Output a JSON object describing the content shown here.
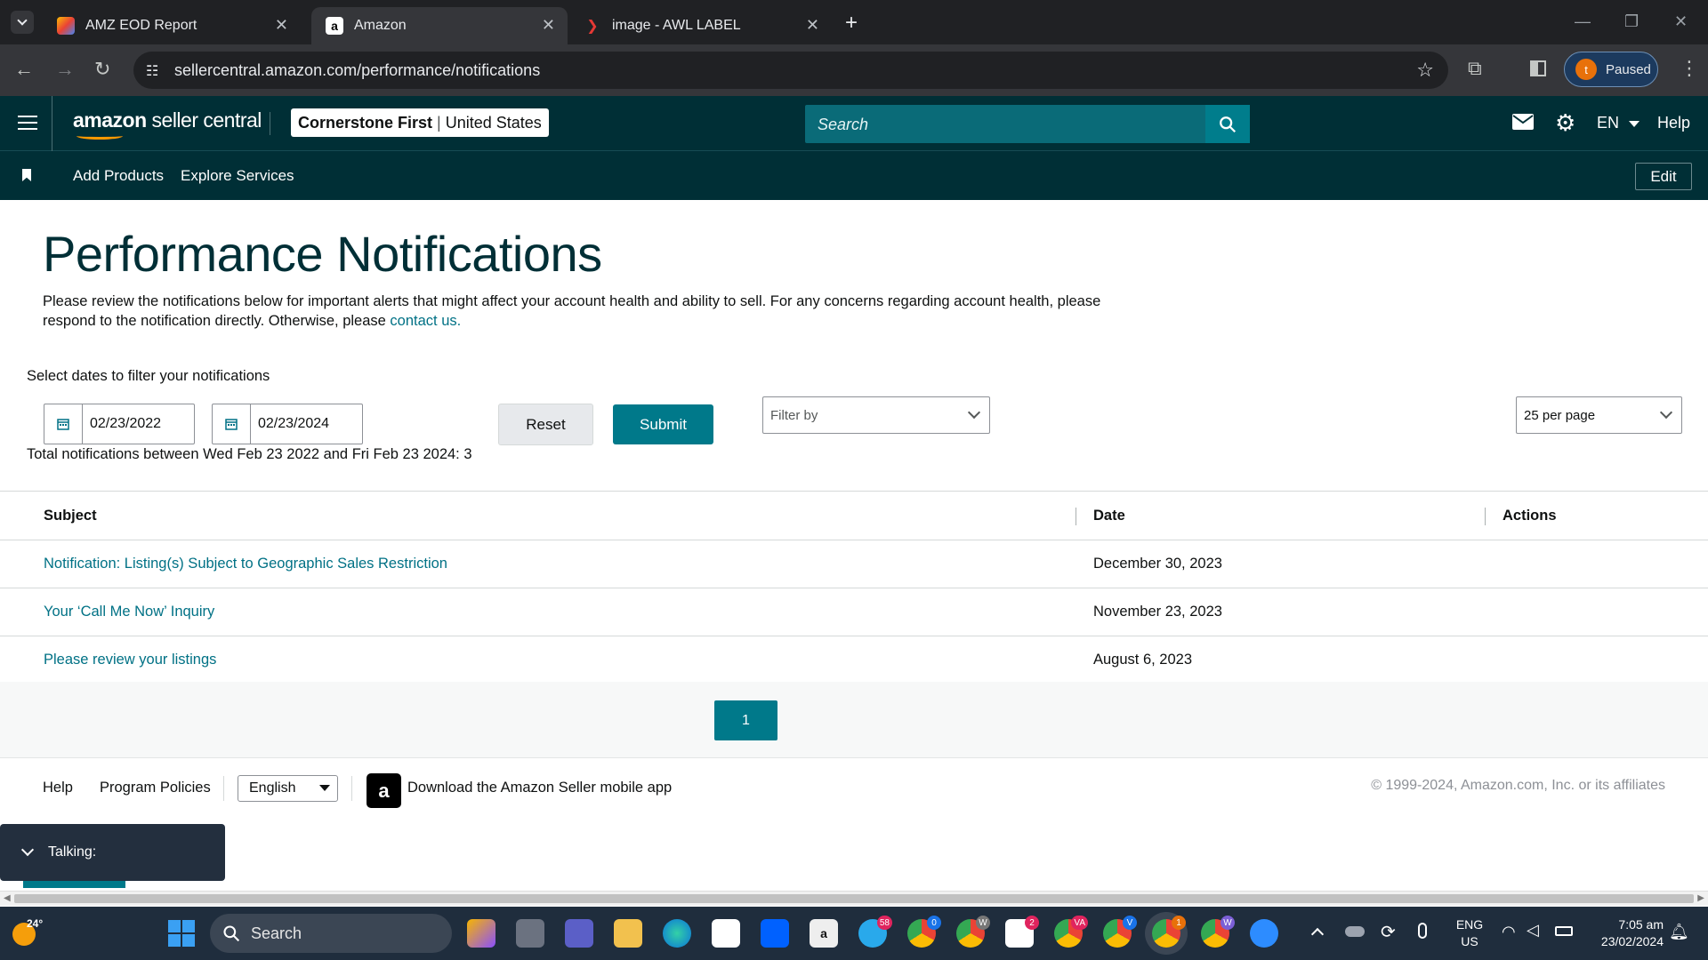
{
  "browser": {
    "tabs": [
      {
        "title": "AMZ EOD Report",
        "icon": "apps-script-icon"
      },
      {
        "title": "Amazon",
        "icon": "amazon-a-icon"
      },
      {
        "title": "image - AWL LABEL",
        "icon": "awl-icon"
      }
    ],
    "url": "sellercentral.amazon.com/performance/notifications",
    "profile": {
      "initial": "t",
      "status": "Paused"
    }
  },
  "header": {
    "logo_bold": "amazon",
    "logo_rest": " seller central",
    "store_name": "Cornerstone First",
    "store_region": "United States",
    "search_placeholder": "Search",
    "language": "EN",
    "help": "Help"
  },
  "subnav": {
    "links": [
      "Add Products",
      "Explore Services"
    ],
    "edit": "Edit"
  },
  "page": {
    "title": "Performance Notifications",
    "intro": "Please review the notifications below for important alerts that might affect your account health and ability to sell. For any concerns regarding account health, please respond to the notification directly. Otherwise, please ",
    "intro_link": "contact us.",
    "filter_label": "Select dates to filter your notifications",
    "date_from": "02/23/2022",
    "date_to": "02/23/2024",
    "reset": "Reset",
    "submit": "Submit",
    "filter_by_placeholder": "Filter by",
    "per_page": "25 per page",
    "total": "Total notifications between Wed Feb 23 2022 and Fri Feb 23 2024: 3"
  },
  "table": {
    "headers": {
      "subject": "Subject",
      "date": "Date",
      "actions": "Actions"
    },
    "rows": [
      {
        "subject": "Notification: Listing(s) Subject to Geographic Sales Restriction",
        "date": "December 30, 2023"
      },
      {
        "subject": "Your ‘Call Me Now’ Inquiry",
        "date": "November 23, 2023"
      },
      {
        "subject": "Please review your listings",
        "date": "August 6, 2023"
      }
    ]
  },
  "pagination": {
    "current": "1"
  },
  "footer": {
    "help": "Help",
    "policies": "Program Policies",
    "language": "English",
    "app": "Download the Amazon Seller mobile app",
    "copyright": "© 1999-2024, Amazon.com, Inc. or its affiliates"
  },
  "talking": {
    "label": "Talking:"
  },
  "taskbar": {
    "weather": "24°",
    "search": "Search",
    "badges": {
      "telegram": "58",
      "chrome1": "0",
      "chrome2": "W",
      "slack": "2",
      "chrome3": "VA",
      "chrome4": "V",
      "chrome5": "1",
      "chrome6": "W"
    },
    "lang_line1": "ENG",
    "lang_line2": "US",
    "time": "7:05 am",
    "date": "23/02/2024"
  },
  "colors": {
    "header_bg": "#002f36",
    "accent": "#00798a",
    "link": "#007185"
  }
}
